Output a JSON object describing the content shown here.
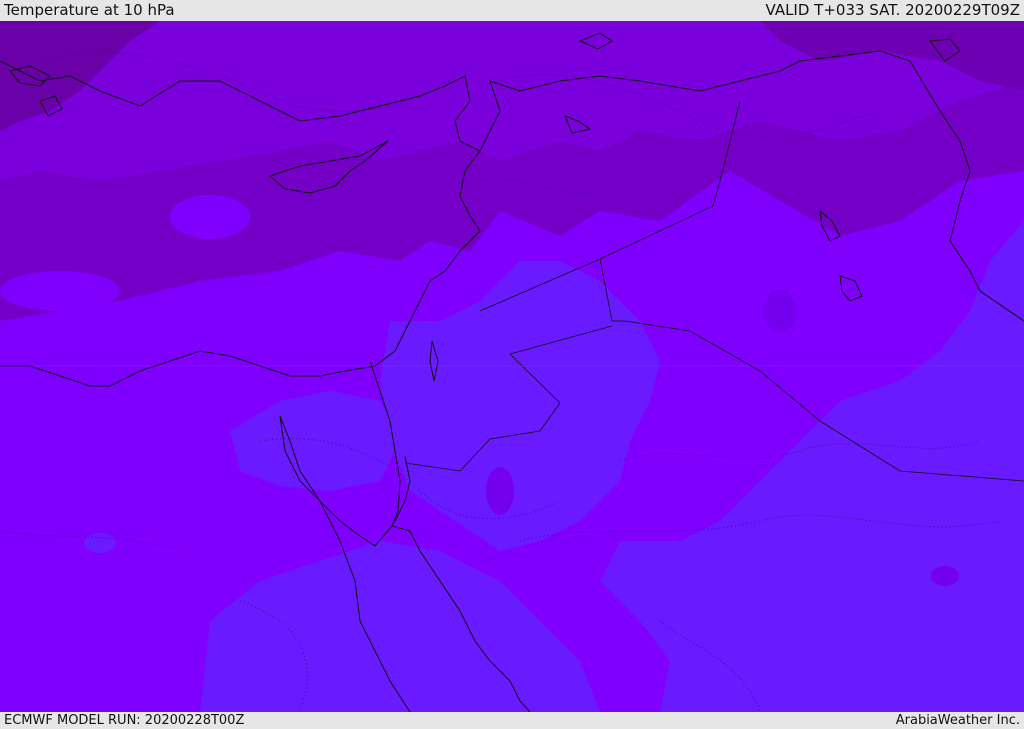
{
  "header": {
    "title": "Temperature at 10 hPa",
    "valid_time": "VALID T+033 SAT. 20200229T09Z"
  },
  "footer": {
    "model_run": "ECMWF MODEL RUN: 20200228T00Z",
    "provider": "ArabiaWeather Inc."
  },
  "colors": {
    "band_darkest": "#6a00a8",
    "band_dark": "#7400c8",
    "band_mid": "#7c00e6",
    "band_light": "#8000ff",
    "band_blue": "#6a1aff",
    "coastline": "#111111"
  }
}
